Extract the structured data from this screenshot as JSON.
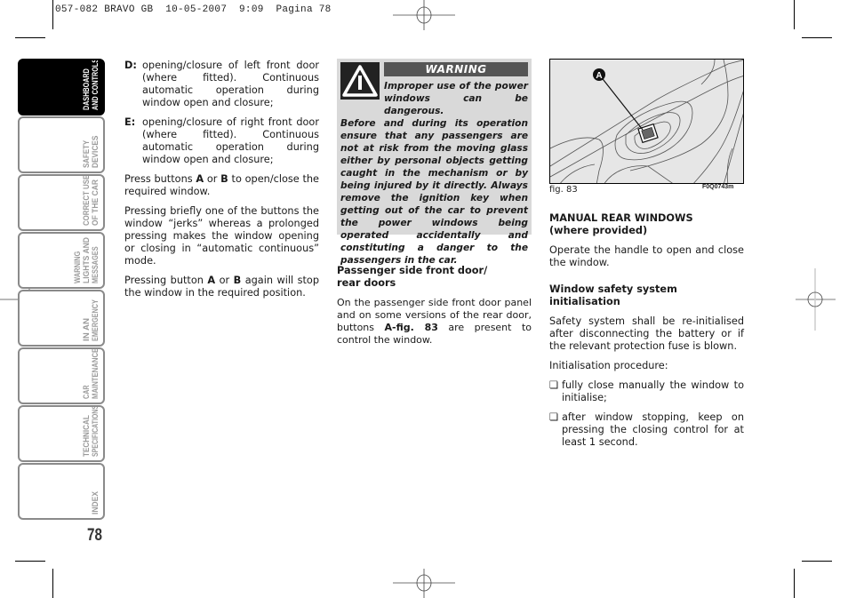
{
  "header": {
    "print_slug": "057-082 BRAVO GB  10-05-2007  9:09  Pagina 78"
  },
  "sidebar": {
    "tabs": [
      {
        "lines": [
          "DASHBOARD",
          "AND CONTROLS"
        ],
        "active": true
      },
      {
        "lines": [
          "SAFETY",
          "DEVICES"
        ],
        "active": false
      },
      {
        "lines": [
          "CORRECT USE",
          "OF THE CAR"
        ],
        "active": false
      },
      {
        "lines": [
          "WARNING",
          "LIGHTS AND",
          "MESSAGES"
        ],
        "active": false
      },
      {
        "lines": [
          "IN AN",
          "EMERGENCY"
        ],
        "active": false
      },
      {
        "lines": [
          "CAR",
          "MAINTENANCE"
        ],
        "active": false
      },
      {
        "lines": [
          "TECHNICAL",
          "SPECIFICATIONS"
        ],
        "active": false
      },
      {
        "lines": [
          "INDEX"
        ],
        "active": false
      }
    ],
    "page_number": "78"
  },
  "col1": {
    "items": [
      {
        "key": "D",
        "text": "opening/closure of left front door (where fitted). Continuous automatic operation during window open and closure;"
      },
      {
        "key": "E",
        "text": "opening/closure of right front door (where fitted). Continuous automatic operation during window open and closure;"
      }
    ],
    "p1": {
      "a": "Press buttons ",
      "b1": "A",
      "c": " or ",
      "b2": "B",
      "d": " to open/close the required window."
    },
    "p2": "Pressing briefly one of the buttons the window “jerks” whereas a prolonged pressing makes the window opening or closing in “automatic continuous” mode.",
    "p3": {
      "a": "Pressing button ",
      "b1": "A",
      "c": " or ",
      "b2": "B",
      "d": " again will stop the window in the required position."
    }
  },
  "warning": {
    "title": "WARNING",
    "lead": "Improper use of the power windows can be dangerous.",
    "body": "Before and during its operation ensure that any passengers are not at risk from the moving glass either by personal objects getting caught in the mechanism or by being injured by it directly. Always remove the ignition key when getting out of the car to prevent the power windows being operated accidentally and constituting a danger to the passengers in the car."
  },
  "col2": {
    "heading": [
      "Passenger side front door/",
      "rear doors"
    ],
    "para": {
      "a": "On the passenger side front door panel and on some versions of the rear door, buttons ",
      "b": "A-fig. 83",
      "c": " are present to control the window."
    }
  },
  "figure": {
    "callout": "A",
    "caption": "fig. 83",
    "code": "F0Q0743m"
  },
  "col3": {
    "heading1": [
      "MANUAL REAR WINDOWS",
      "(where provided)"
    ],
    "p1": "Operate the handle to open and close the window.",
    "heading2": "Window safety system initialisation",
    "p2": "Safety system shall be re-initialised after disconnecting the battery or if the relevant protection fuse is blown.",
    "p3": "Initialisation procedure:",
    "bullets": [
      "fully close manually the window to initialise;",
      "after window stopping, keep on pressing the closing control for at least 1 second."
    ],
    "bullet_glyph": "❏"
  }
}
